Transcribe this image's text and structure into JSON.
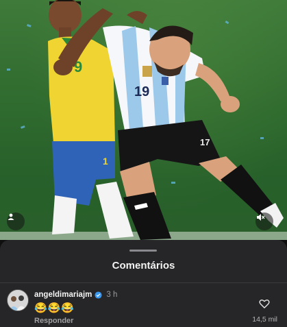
{
  "sheet": {
    "title": "Comentários"
  },
  "comment": {
    "username": "angeldimariajm",
    "time": "3 h",
    "text": "😂😂😂",
    "reply_label": "Responder",
    "like_count": "14,5 mil"
  },
  "photo": {
    "jersey_number": "19"
  },
  "colors": {
    "sheet_bg": "#262628",
    "verified": "#3897f0",
    "pitch": "#2f6a2e"
  },
  "icons": [
    "user-tag-icon",
    "mute-icon",
    "verified-icon",
    "heart-icon"
  ]
}
